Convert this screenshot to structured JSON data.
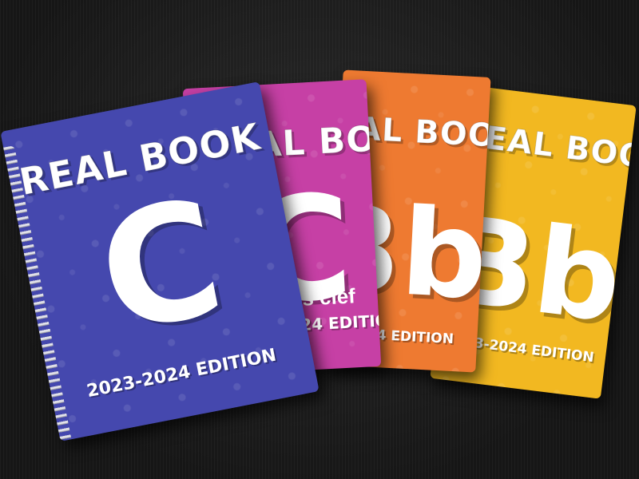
{
  "books": [
    {
      "id": "yellow",
      "title": "REAL BOOK",
      "key": "Bb",
      "subtitle": "",
      "edition": "2023-2024 EDITION",
      "color": "#f2b821",
      "dark": "#d49a10"
    },
    {
      "id": "orange",
      "title": "REAL BOOK",
      "key": "Bb",
      "subtitle": "",
      "edition": "2023-2024 EDITION",
      "color": "#ee7a31",
      "dark": "#d1621d"
    },
    {
      "id": "magenta",
      "title": "REAL BOOK",
      "key": "C",
      "subtitle": "Bass clef",
      "edition": "2023-2024 EDITION",
      "color": "#c640a5",
      "dark": "#a22d86"
    },
    {
      "id": "blue",
      "title": "REAL BOOK",
      "key": "C",
      "subtitle": "",
      "edition": "2023-2024 EDITION",
      "color": "#4548ae",
      "dark": "#333694"
    }
  ]
}
